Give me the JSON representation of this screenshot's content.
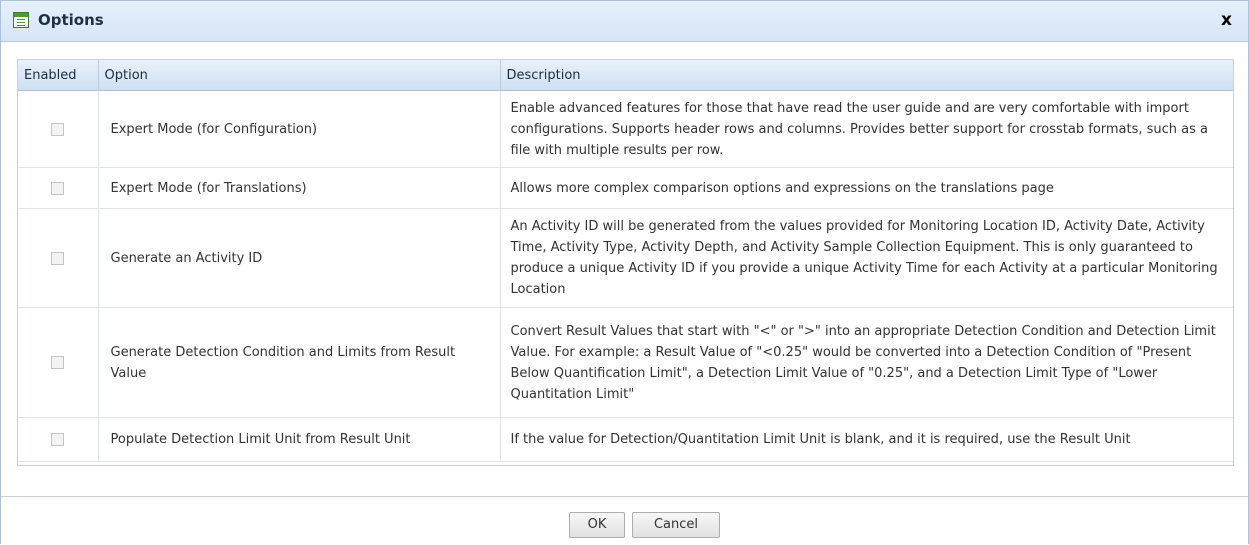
{
  "dialog": {
    "title": "Options",
    "close_label": "x",
    "icon": "list-icon"
  },
  "grid": {
    "columns": [
      "Enabled",
      "Option",
      "Description"
    ],
    "rows": [
      {
        "enabled": false,
        "option": "Expert Mode (for Configuration)",
        "description": "Enable advanced features for those that have read the user guide and are very comfortable with import configurations. Supports header rows and columns. Provides better support for crosstab formats, such as a file with multiple results per row."
      },
      {
        "enabled": false,
        "option": "Expert Mode (for Translations)",
        "description": "Allows more complex comparison options and expressions on the translations page"
      },
      {
        "enabled": false,
        "option": "Generate an Activity ID",
        "description": "An Activity ID will be generated from the values provided for Monitoring Location ID, Activity Date, Activity Time, Activity Type, Activity Depth, and Activity Sample Collection Equipment. This is only guaranteed to produce a unique Activity ID if you provide a unique Activity Time for each Activity at a particular Monitoring Location"
      },
      {
        "enabled": false,
        "option": "Generate Detection Condition and Limits from Result Value",
        "description": "Convert Result Values that start with \"<\" or \">\" into an appropriate Detection Condition and Detection Limit Value. For example: a Result Value of \"<0.25\" would be converted into a Detection Condition of \"Present Below Quantification Limit\", a Detection Limit Value of \"0.25\", and a Detection Limit Type of \"Lower Quantitation Limit\""
      },
      {
        "enabled": false,
        "option": "Populate Detection Limit Unit from Result Unit",
        "description": "If the value for Detection/Quantitation Limit Unit is blank, and it is required, use the Result Unit"
      }
    ]
  },
  "footer": {
    "ok_label": "OK",
    "cancel_label": "Cancel"
  },
  "colors": {
    "titlebar": "#d9e7f7",
    "header": "#d6e4f4",
    "border": "#a9c2df"
  }
}
